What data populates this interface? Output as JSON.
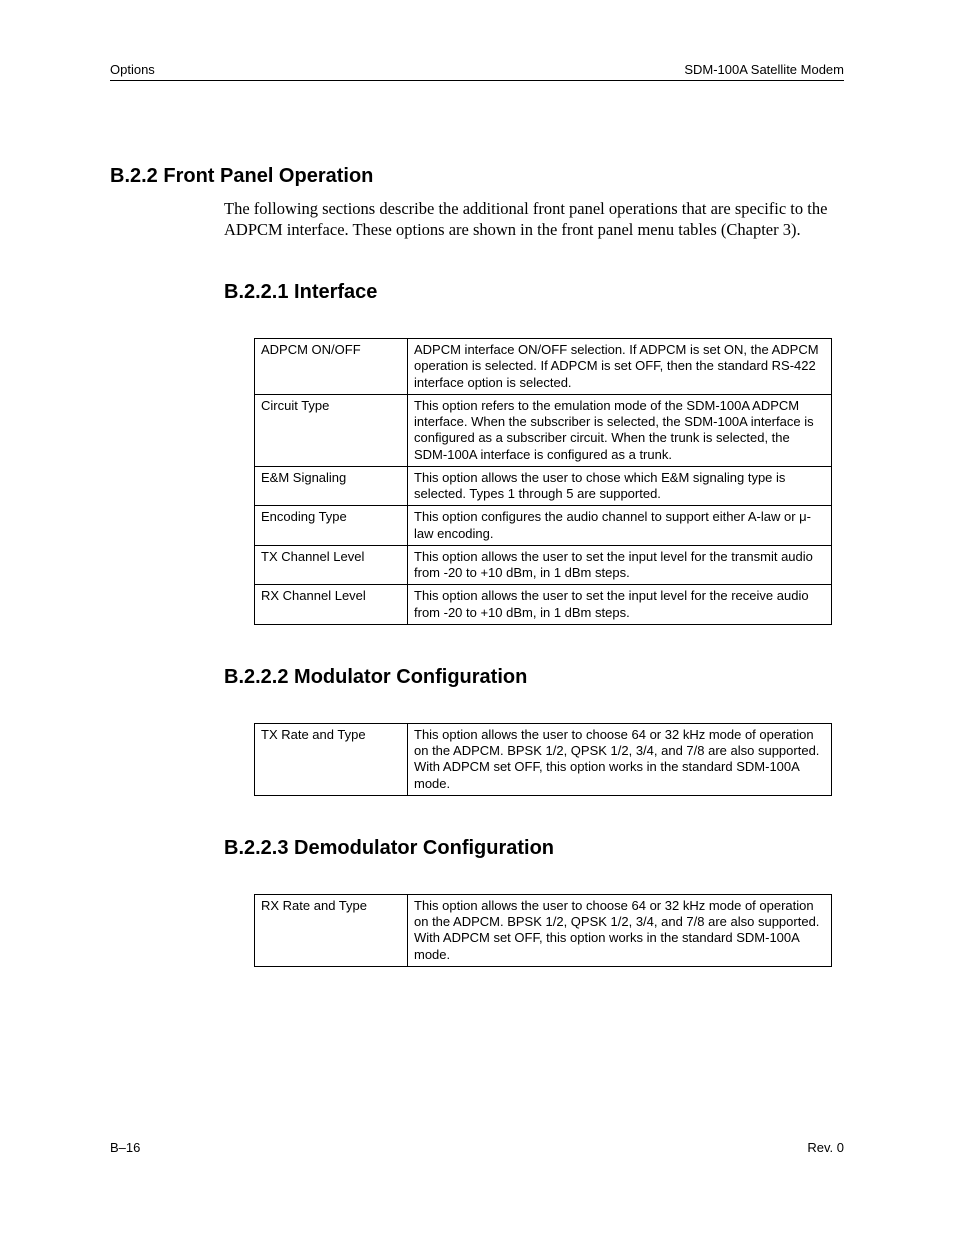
{
  "header": {
    "left": "Options",
    "right": "SDM-100A Satellite Modem"
  },
  "section_b22": {
    "title": "B.2.2  Front Panel Operation",
    "body": "The following sections describe the additional front panel operations that are specific to the ADPCM interface. These options are shown in the front panel menu tables (Chapter 3)."
  },
  "section_b221": {
    "title": "B.2.2.1  Interface",
    "rows": [
      {
        "label": "ADPCM ON/OFF",
        "desc": "ADPCM interface ON/OFF selection. If ADPCM is set ON, the ADPCM operation is selected. If ADPCM is set OFF, then the standard RS-422 interface option is selected."
      },
      {
        "label": "Circuit Type",
        "desc": "This option refers to the emulation mode of the SDM-100A ADPCM interface. When the subscriber is selected, the SDM-100A interface is configured as a subscriber circuit. When the trunk is selected, the SDM-100A interface is configured as a trunk."
      },
      {
        "label": "E&M Signaling",
        "desc": "This option allows the user to chose which E&M signaling type is selected. Types 1 through 5 are supported."
      },
      {
        "label": "Encoding Type",
        "desc": "This option configures the audio channel to support either A-law or μ-law encoding."
      },
      {
        "label": "TX Channel Level",
        "desc": "This option allows the user to set the input level for the transmit audio from -20 to +10 dBm, in 1 dBm steps."
      },
      {
        "label": "RX Channel Level",
        "desc": "This option allows the user to set the input level for the receive audio from -20 to +10 dBm, in 1 dBm steps."
      }
    ]
  },
  "section_b222": {
    "title": "B.2.2.2  Modulator Configuration",
    "rows": [
      {
        "label": "TX Rate and Type",
        "desc": "This option allows the user to choose 64 or 32 kHz mode of operation on the ADPCM. BPSK 1/2, QPSK 1/2, 3/4, and 7/8 are also supported. With ADPCM set OFF, this option works in the standard SDM-100A mode."
      }
    ]
  },
  "section_b223": {
    "title": "B.2.2.3  Demodulator Configuration",
    "rows": [
      {
        "label": "RX Rate and Type",
        "desc": "This option allows the user to choose 64 or 32 kHz mode of operation on the ADPCM. BPSK 1/2, QPSK 1/2, 3/4, and 7/8 are also supported. With ADPCM set OFF, this option works in the standard SDM-100A mode."
      }
    ]
  },
  "footer": {
    "left": "B–16",
    "right": "Rev. 0"
  }
}
